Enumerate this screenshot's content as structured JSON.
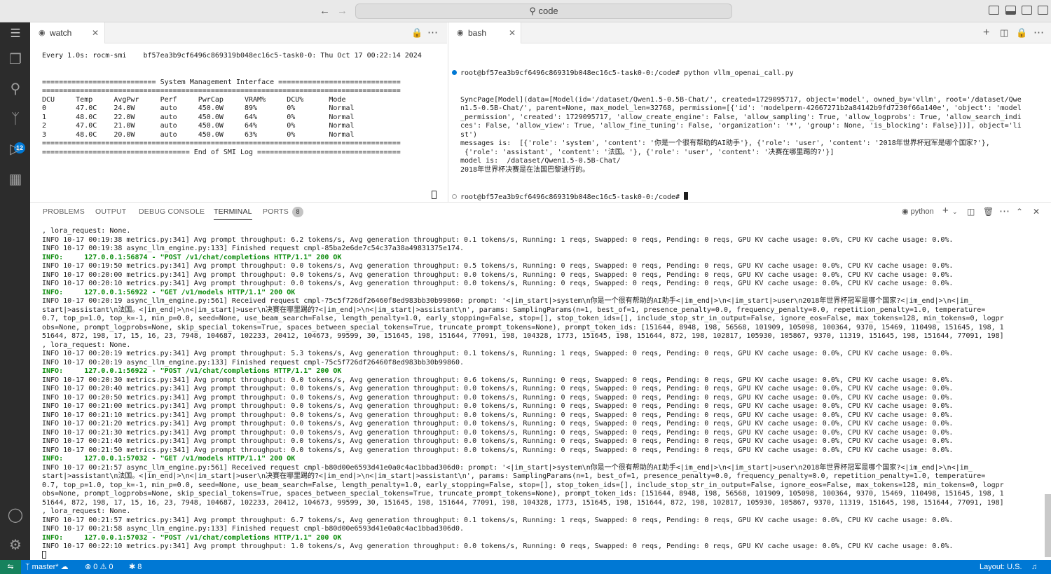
{
  "titlebar": {
    "search_text": "code",
    "search_icon": "search-icon"
  },
  "activity": {
    "scm_badge": "12"
  },
  "watch_editor": {
    "tab_label": "watch",
    "lines": [
      "Every 1.0s: rocm-smi    bf57ea3b9cf6496c869319b048ec16c5-task0-0: Thu Oct 17 00:22:14 2024",
      "",
      "",
      "=========================== System Management Interface =============================",
      "=====================================================================================",
      "DCU     Temp     AvgPwr     Perf     PwrCap     VRAM%     DCU%      Mode",
      "0       47.0C    24.0W      auto     450.0W     89%       0%        Normal",
      "1       48.0C    22.0W      auto     450.0W     64%       0%        Normal",
      "2       47.0C    21.0W      auto     450.0W     64%       0%        Normal",
      "3       48.0C    20.0W      auto     450.0W     63%       0%        Normal",
      "=====================================================================================",
      "=================================== End of SMI Log =================================="
    ]
  },
  "bash_editor": {
    "tab_label": "bash",
    "first_line": "root@bf57ea3b9cf6496c869319b048ec16c5-task0-0:/code# python vllm_openai_call.py",
    "lines": [
      "SyncPage[Model](data=[Model(id='/dataset/Qwen1.5-0.5B-Chat/', created=1729095717, object='model', owned_by='vllm', root='/dataset/Qwe",
      "n1.5-0.5B-Chat/', parent=None, max_model_len=32768, permission=[{'id': 'modelperm-42667271b2a84142b9fd7230f66a140e', 'object': 'model",
      "_permission', 'created': 1729095717, 'allow_create_engine': False, 'allow_sampling': True, 'allow_logprobs': True, 'allow_search_indi",
      "ces': False, 'allow_view': True, 'allow_fine_tuning': False, 'organization': '*', 'group': None, 'is_blocking': False}])], object='li",
      "st')",
      "messages is:  [{'role': 'system', 'content': '你是一个很有帮助的AI助手'}, {'role': 'user', 'content': '2018年世界杯冠军是哪个国家?'},",
      " {'role': 'assistant', 'content': '法国。'}, {'role': 'user', 'content': '决赛在哪里踢的?'}]",
      "model is:  /dataset/Qwen1.5-0.5B-Chat/",
      "2018年世界杯决赛是在法国巴黎进行的。"
    ],
    "prompt_line": "root@bf57ea3b9cf6496c869319b048ec16c5-task0-0:/code# "
  },
  "panel": {
    "tabs": [
      "PROBLEMS",
      "OUTPUT",
      "DEBUG CONSOLE",
      "TERMINAL",
      "PORTS"
    ],
    "ports_count": "8",
    "shell_label": "python",
    "terminal_lines": [
      ", lora_request: None.",
      "INFO 10-17 00:19:38 metrics.py:341] Avg prompt throughput: 6.2 tokens/s, Avg generation throughput: 0.1 tokens/s, Running: 1 reqs, Swapped: 0 reqs, Pending: 0 reqs, GPU KV cache usage: 0.0%, CPU KV cache usage: 0.0%.",
      "INFO 10-17 00:19:38 async_llm_engine.py:133] Finished request cmpl-85ba2e6de7c54c37a38a49831375e174.",
      "INFO:     127.0.0.1:56874 - \"POST /v1/chat/completions HTTP/1.1\" 200 OK",
      "INFO 10-17 00:19:50 metrics.py:341] Avg prompt throughput: 0.0 tokens/s, Avg generation throughput: 0.5 tokens/s, Running: 0 reqs, Swapped: 0 reqs, Pending: 0 reqs, GPU KV cache usage: 0.0%, CPU KV cache usage: 0.0%.",
      "INFO 10-17 00:20:00 metrics.py:341] Avg prompt throughput: 0.0 tokens/s, Avg generation throughput: 0.0 tokens/s, Running: 0 reqs, Swapped: 0 reqs, Pending: 0 reqs, GPU KV cache usage: 0.0%, CPU KV cache usage: 0.0%.",
      "INFO 10-17 00:20:10 metrics.py:341] Avg prompt throughput: 0.0 tokens/s, Avg generation throughput: 0.0 tokens/s, Running: 0 reqs, Swapped: 0 reqs, Pending: 0 reqs, GPU KV cache usage: 0.0%, CPU KV cache usage: 0.0%.",
      "INFO:     127.0.0.1:56922 - \"GET /v1/models HTTP/1.1\" 200 OK",
      "INFO 10-17 00:20:19 async_llm_engine.py:561] Received request cmpl-75c5f726df26460f8ed983bb30b99860: prompt: '<|im_start|>system\\n你是一个很有帮助的AI助手<|im_end|>\\n<|im_start|>user\\n2018年世界杯冠军是哪个国家?<|im_end|>\\n<|im_",
      "start|>assistant\\n法国。<|im_end|>\\n<|im_start|>user\\n决赛在哪里踢的?<|im_end|>\\n<|im_start|>assistant\\n', params: SamplingParams(n=1, best_of=1, presence_penalty=0.0, frequency_penalty=0.0, repetition_penalty=1.0, temperature=",
      "0.7, top_p=1.0, top_k=-1, min_p=0.0, seed=None, use_beam_search=False, length_penalty=1.0, early_stopping=False, stop=[], stop_token_ids=[], include_stop_str_in_output=False, ignore_eos=False, max_tokens=128, min_tokens=0, logpr",
      "obs=None, prompt_logprobs=None, skip_special_tokens=True, spaces_between_special_tokens=True, truncate_prompt_tokens=None), prompt_token_ids: [151644, 8948, 198, 56568, 101909, 105098, 100364, 9370, 15469, 110498, 151645, 198, 1",
      "51644, 872, 198, 17, 15, 16, 23, 7948, 104687, 102233, 20412, 104673, 99599, 30, 151645, 198, 151644, 77091, 198, 104328, 1773, 151645, 198, 151644, 872, 198, 102817, 105930, 105867, 9370, 11319, 151645, 198, 151644, 77091, 198]",
      ", lora_request: None.",
      "INFO 10-17 00:20:19 metrics.py:341] Avg prompt throughput: 5.3 tokens/s, Avg generation throughput: 0.1 tokens/s, Running: 1 reqs, Swapped: 0 reqs, Pending: 0 reqs, GPU KV cache usage: 0.0%, CPU KV cache usage: 0.0%.",
      "INFO 10-17 00:20:19 async_llm_engine.py:133] Finished request cmpl-75c5f726df26460f8ed983bb30b99860.",
      "INFO:     127.0.0.1:56922 - \"POST /v1/chat/completions HTTP/1.1\" 200 OK",
      "INFO 10-17 00:20:30 metrics.py:341] Avg prompt throughput: 0.0 tokens/s, Avg generation throughput: 0.6 tokens/s, Running: 0 reqs, Swapped: 0 reqs, Pending: 0 reqs, GPU KV cache usage: 0.0%, CPU KV cache usage: 0.0%.",
      "INFO 10-17 00:20:40 metrics.py:341] Avg prompt throughput: 0.0 tokens/s, Avg generation throughput: 0.0 tokens/s, Running: 0 reqs, Swapped: 0 reqs, Pending: 0 reqs, GPU KV cache usage: 0.0%, CPU KV cache usage: 0.0%.",
      "INFO 10-17 00:20:50 metrics.py:341] Avg prompt throughput: 0.0 tokens/s, Avg generation throughput: 0.0 tokens/s, Running: 0 reqs, Swapped: 0 reqs, Pending: 0 reqs, GPU KV cache usage: 0.0%, CPU KV cache usage: 0.0%.",
      "INFO 10-17 00:21:00 metrics.py:341] Avg prompt throughput: 0.0 tokens/s, Avg generation throughput: 0.0 tokens/s, Running: 0 reqs, Swapped: 0 reqs, Pending: 0 reqs, GPU KV cache usage: 0.0%, CPU KV cache usage: 0.0%.",
      "INFO 10-17 00:21:10 metrics.py:341] Avg prompt throughput: 0.0 tokens/s, Avg generation throughput: 0.0 tokens/s, Running: 0 reqs, Swapped: 0 reqs, Pending: 0 reqs, GPU KV cache usage: 0.0%, CPU KV cache usage: 0.0%.",
      "INFO 10-17 00:21:20 metrics.py:341] Avg prompt throughput: 0.0 tokens/s, Avg generation throughput: 0.0 tokens/s, Running: 0 reqs, Swapped: 0 reqs, Pending: 0 reqs, GPU KV cache usage: 0.0%, CPU KV cache usage: 0.0%.",
      "INFO 10-17 00:21:30 metrics.py:341] Avg prompt throughput: 0.0 tokens/s, Avg generation throughput: 0.0 tokens/s, Running: 0 reqs, Swapped: 0 reqs, Pending: 0 reqs, GPU KV cache usage: 0.0%, CPU KV cache usage: 0.0%.",
      "INFO 10-17 00:21:40 metrics.py:341] Avg prompt throughput: 0.0 tokens/s, Avg generation throughput: 0.0 tokens/s, Running: 0 reqs, Swapped: 0 reqs, Pending: 0 reqs, GPU KV cache usage: 0.0%, CPU KV cache usage: 0.0%.",
      "INFO 10-17 00:21:50 metrics.py:341] Avg prompt throughput: 0.0 tokens/s, Avg generation throughput: 0.0 tokens/s, Running: 0 reqs, Swapped: 0 reqs, Pending: 0 reqs, GPU KV cache usage: 0.0%, CPU KV cache usage: 0.0%.",
      "INFO:     127.0.0.1:57032 - \"GET /v1/models HTTP/1.1\" 200 OK",
      "INFO 10-17 00:21:57 async_llm_engine.py:561] Received request cmpl-b80d00e6593d41e0a0c4ac1bbad306d0: prompt: '<|im_start|>system\\n你是一个很有帮助的AI助手<|im_end|>\\n<|im_start|>user\\n2018年世界杯冠军是哪个国家?<|im_end|>\\n<|im_",
      "start|>assistant\\n法国。<|im_end|>\\n<|im_start|>user\\n决赛在哪里踢的?<|im_end|>\\n<|im_start|>assistant\\n', params: SamplingParams(n=1, best_of=1, presence_penalty=0.0, frequency_penalty=0.0, repetition_penalty=1.0, temperature=",
      "0.7, top_p=1.0, top_k=-1, min_p=0.0, seed=None, use_beam_search=False, length_penalty=1.0, early_stopping=False, stop=[], stop_token_ids=[], include_stop_str_in_output=False, ignore_eos=False, max_tokens=128, min_tokens=0, logpr",
      "obs=None, prompt_logprobs=None, skip_special_tokens=True, spaces_between_special_tokens=True, truncate_prompt_tokens=None), prompt_token_ids: [151644, 8948, 198, 56568, 101909, 105098, 100364, 9370, 15469, 110498, 151645, 198, 1",
      "51644, 872, 198, 17, 15, 16, 23, 7948, 104687, 102233, 20412, 104673, 99599, 30, 151645, 198, 151644, 77091, 198, 104328, 1773, 151645, 198, 151644, 872, 198, 102817, 105930, 105867, 9370, 11319, 151645, 198, 151644, 77091, 198]",
      ", lora_request: None.",
      "INFO 10-17 00:21:57 metrics.py:341] Avg prompt throughput: 6.7 tokens/s, Avg generation throughput: 0.1 tokens/s, Running: 1 reqs, Swapped: 0 reqs, Pending: 0 reqs, GPU KV cache usage: 0.0%, CPU KV cache usage: 0.0%.",
      "INFO 10-17 00:21:58 async_llm_engine.py:133] Finished request cmpl-b80d00e6593d41e0a0c4ac1bbad306d0.",
      "INFO:     127.0.0.1:57032 - \"POST /v1/chat/completions HTTP/1.1\" 200 OK",
      "INFO 10-17 00:22:10 metrics.py:341] Avg prompt throughput: 1.0 tokens/s, Avg generation throughput: 0.0 tokens/s, Running: 0 reqs, Swapped: 0 reqs, Pending: 0 reqs, GPU KV cache usage: 0.0%, CPU KV cache usage: 0.0%."
    ]
  },
  "statusbar": {
    "branch": "master*",
    "errors": "0",
    "warnings": "0",
    "ports": "8",
    "layout": "Layout: U.S."
  },
  "colors": {
    "accent": "#0078d4",
    "remote": "#16825d",
    "activity_bg": "#2c2c2c",
    "info_green": "#0c8a0c"
  }
}
